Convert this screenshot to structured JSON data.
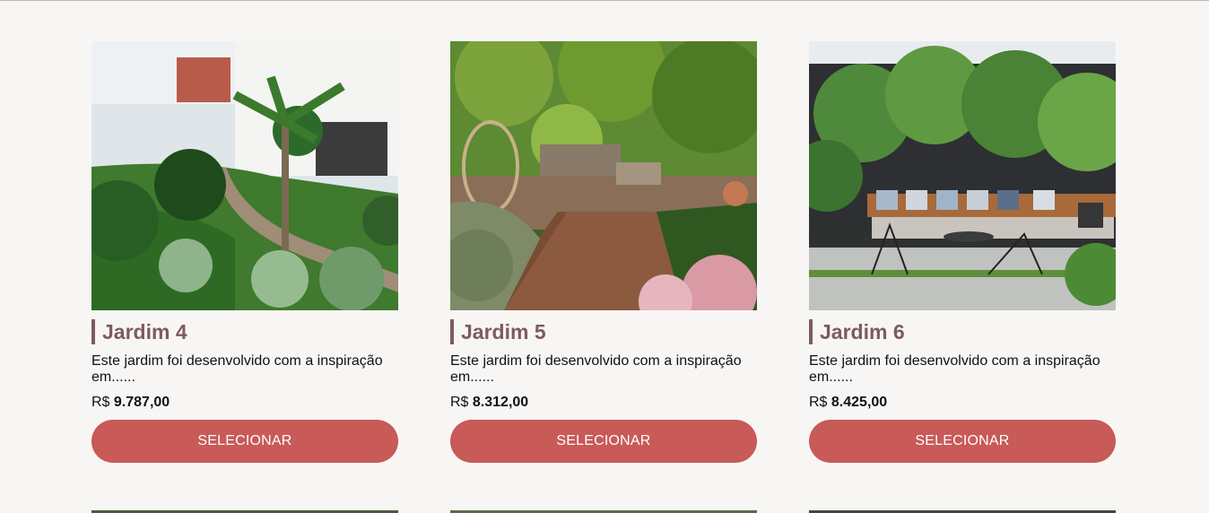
{
  "products": [
    {
      "title": "Jardim 4",
      "description": "Este jardim foi desenvolvido com a inspiração em......",
      "currency": "R$",
      "price": "9.787,00",
      "button_label": "SELECIONAR"
    },
    {
      "title": "Jardim 5",
      "description": "Este jardim foi desenvolvido com a inspiração em......",
      "currency": "R$",
      "price": "8.312,00",
      "button_label": "SELECIONAR"
    },
    {
      "title": "Jardim 6",
      "description": "Este jardim foi desenvolvido com a inspiração em......",
      "currency": "R$",
      "price": "8.425,00",
      "button_label": "SELECIONAR"
    }
  ],
  "colors": {
    "accent": "#c85a57",
    "title": "#7d5b5d",
    "background": "#f8f6f5"
  }
}
